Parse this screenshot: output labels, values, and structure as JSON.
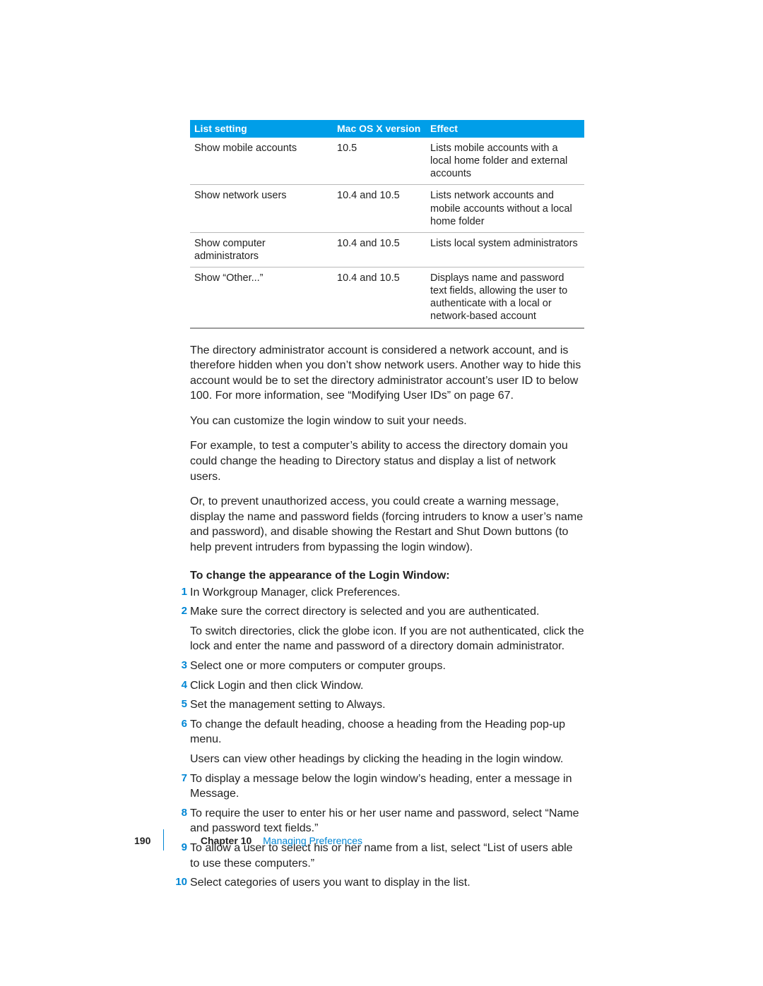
{
  "table": {
    "headers": {
      "setting": "List setting",
      "version": "Mac OS X version",
      "effect": "Effect"
    },
    "rows": [
      {
        "setting": "Show mobile accounts",
        "version": "10.5",
        "effect": "Lists mobile accounts with a local home folder and external accounts"
      },
      {
        "setting": "Show network users",
        "version": "10.4 and 10.5",
        "effect": "Lists network accounts and mobile accounts without a local home folder"
      },
      {
        "setting": "Show computer administrators",
        "version": "10.4 and 10.5",
        "effect": "Lists local system administrators"
      },
      {
        "setting": "Show “Other...”",
        "version": "10.4 and 10.5",
        "effect": "Displays name and password text fields, allowing the user to authenticate with a local or network-based account"
      }
    ]
  },
  "paras": {
    "p1": "The directory administrator account is considered a network account, and is therefore hidden when you don’t show network users. Another way to hide this account would be to set the directory administrator account’s user ID to below 100. For more information, see “Modifying User IDs” on page 67.",
    "p2": "You can customize the login window to suit your needs.",
    "p3": "For example, to test a computer’s ability to access the directory domain you could change the heading to Directory status and display a list of network users.",
    "p4": "Or, to prevent unauthorized access, you could create a warning message, display the name and password fields (forcing intruders to know a user’s name and password), and disable showing the Restart and Shut Down buttons (to help prevent intruders from bypassing the login window)."
  },
  "procedureTitle": "To change the appearance of the Login Window:",
  "steps": [
    {
      "num": "1",
      "paras": [
        "In Workgroup Manager, click Preferences."
      ]
    },
    {
      "num": "2",
      "paras": [
        "Make sure the correct directory is selected and you are authenticated.",
        "To switch directories, click the globe icon. If you are not authenticated, click the lock and enter the name and password of a directory domain administrator."
      ]
    },
    {
      "num": "3",
      "paras": [
        "Select one or more computers or computer groups."
      ]
    },
    {
      "num": "4",
      "paras": [
        "Click Login and then click Window."
      ]
    },
    {
      "num": "5",
      "paras": [
        "Set the management setting to Always."
      ]
    },
    {
      "num": "6",
      "paras": [
        "To change the default heading, choose a heading from the Heading pop-up menu.",
        "Users can view other headings by clicking the heading in the login window."
      ]
    },
    {
      "num": "7",
      "paras": [
        "To display a message below the login window’s heading, enter a message in Message."
      ]
    },
    {
      "num": "8",
      "paras": [
        "To require the user to enter his or her user name and password, select “Name and password text fields.”"
      ]
    },
    {
      "num": "9",
      "paras": [
        "To allow a user to select his or her name from a list, select “List of users able to use these computers.”"
      ]
    },
    {
      "num": "10",
      "paras": [
        "Select categories of users you want to display in the list."
      ]
    }
  ],
  "footer": {
    "page": "190",
    "chapterLabel": "Chapter 10",
    "chapterTitle": "Managing Preferences"
  }
}
